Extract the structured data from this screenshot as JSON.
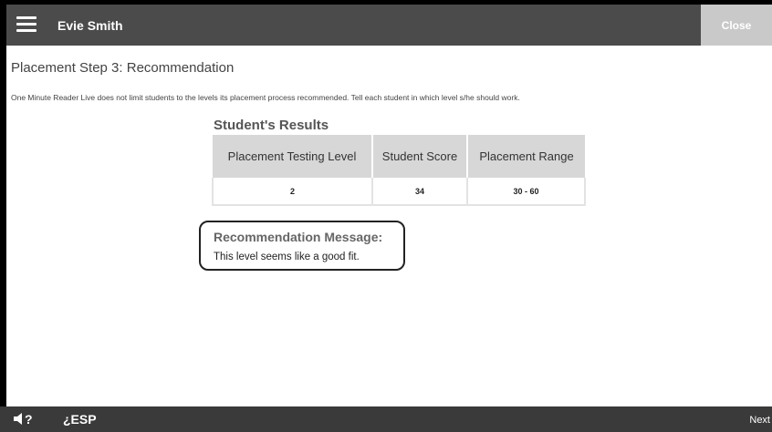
{
  "header": {
    "user_name": "Evie Smith",
    "close_label": "Close"
  },
  "page": {
    "step_title": "Placement Step 3: Recommendation",
    "intro": "One Minute Reader Live does not limit students to the levels its placement process recommended. Tell each student in which level s/he should work."
  },
  "results": {
    "title": "Student's Results",
    "headers": [
      "Placement Testing Level",
      "Student Score",
      "Placement Range"
    ],
    "row": [
      "2",
      "34",
      "30 - 60"
    ]
  },
  "recommendation": {
    "title": "Recommendation Message:",
    "message": "This level seems like a good fit."
  },
  "footer": {
    "audio_help_label": "?",
    "esp_label": "¿ESP",
    "next_label": "Next"
  },
  "colors": {
    "top_bar": "#4b4b4b",
    "close_button": "#c9c9c9",
    "bottom_bar": "#3a3a3a",
    "table_header": "#d7d7d7"
  },
  "icons": [
    "hamburger-menu-icon",
    "speaker-icon"
  ]
}
